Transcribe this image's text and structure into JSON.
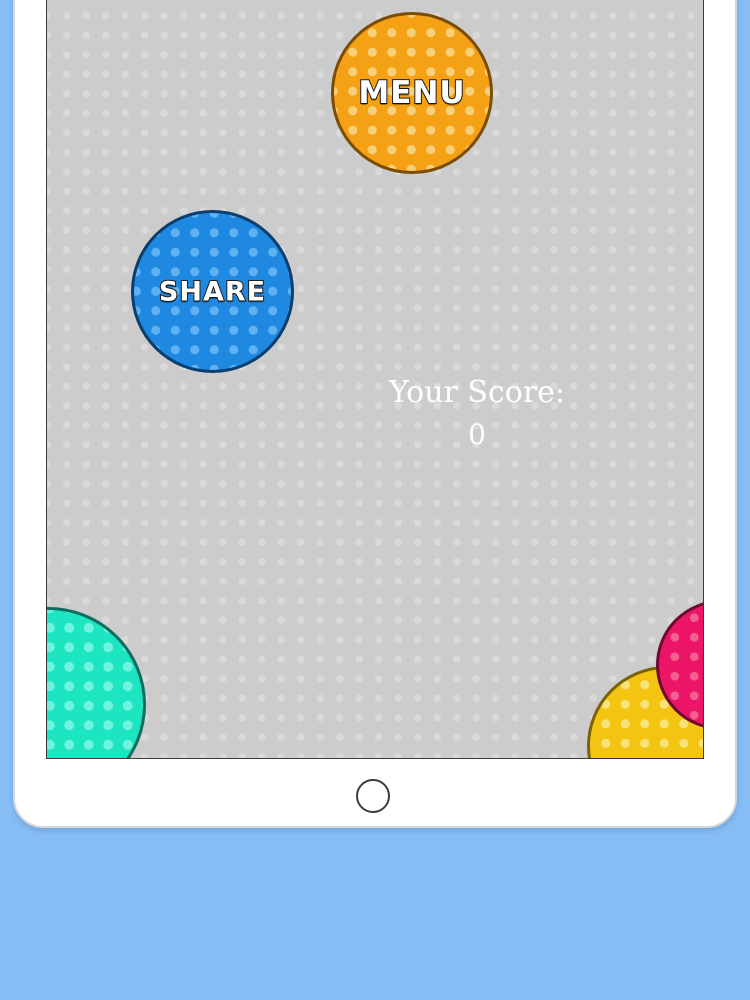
{
  "buttons": {
    "menu_label": "MENU",
    "share_label": "SHARE"
  },
  "score": {
    "label": "Your Score:",
    "value": "0"
  },
  "colors": {
    "background": "#86bdf5",
    "playfield": "#cccccc",
    "menu_ball": "#f5a115",
    "share_ball": "#1f88e0",
    "teal_ball": "#1de5c2",
    "yellow_ball": "#f3c412",
    "pink_ball": "#ec1567"
  }
}
